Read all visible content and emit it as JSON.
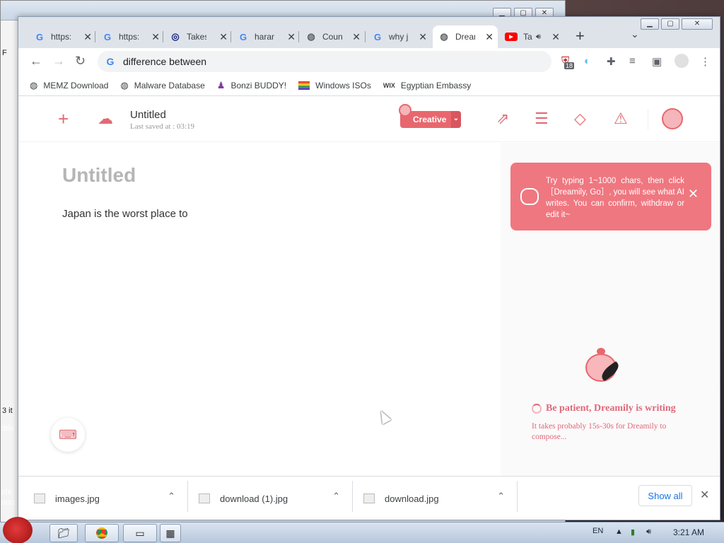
{
  "browser": {
    "tabs": [
      {
        "label": "https:",
        "favicon": "google-icon"
      },
      {
        "label": "https:",
        "favicon": "google-icon"
      },
      {
        "label": "Takes",
        "favicon": "circle-site-icon"
      },
      {
        "label": "haran",
        "favicon": "google-icon"
      },
      {
        "label": "Count",
        "favicon": "globe-icon"
      },
      {
        "label": "why j",
        "favicon": "google-icon"
      },
      {
        "label": "Drean",
        "favicon": "globe-icon",
        "active": true
      },
      {
        "label": "Ta",
        "favicon": "youtube-icon",
        "audio": true
      }
    ],
    "address": "difference between",
    "bookmarks": [
      {
        "label": "MEMZ Download",
        "icon": "globe-icon"
      },
      {
        "label": "Malware Database",
        "icon": "globe-icon"
      },
      {
        "label": "Bonzi BUDDY!",
        "icon": "bonzi-icon"
      },
      {
        "label": "Windows ISOs",
        "icon": "windows-flag-icon"
      },
      {
        "label": "Egyptian Embassy",
        "icon": "wix-icon",
        "icon_text": "WIX"
      }
    ],
    "extension_badge": "18"
  },
  "app": {
    "doc_title": "Untitled",
    "last_saved": "Last saved at : 03:19",
    "mode_button": "Creative",
    "editor_title": "Untitled",
    "editor_body": "Japan is the worst place to",
    "tip_text": "Try typing 1~1000 chars, then click［Dreamily, Go］, you will see what AI writes. You can confirm, withdraw or edit it~",
    "wait_title": "Be patient, Dreamily is writing",
    "wait_sub": "It takes probably 15s-30s for Dreamily to compose...",
    "accent_color": "#e8676e"
  },
  "downloads": {
    "items": [
      {
        "name": "images.jpg"
      },
      {
        "name": "download (1).jpg"
      },
      {
        "name": "download.jpg"
      }
    ],
    "show_all": "Show all"
  },
  "background": {
    "fragments": [
      "F",
      "3 it",
      "driv",
      "chr",
      "norr"
    ]
  },
  "taskbar": {
    "lang": "EN",
    "time": "3:21 AM"
  }
}
